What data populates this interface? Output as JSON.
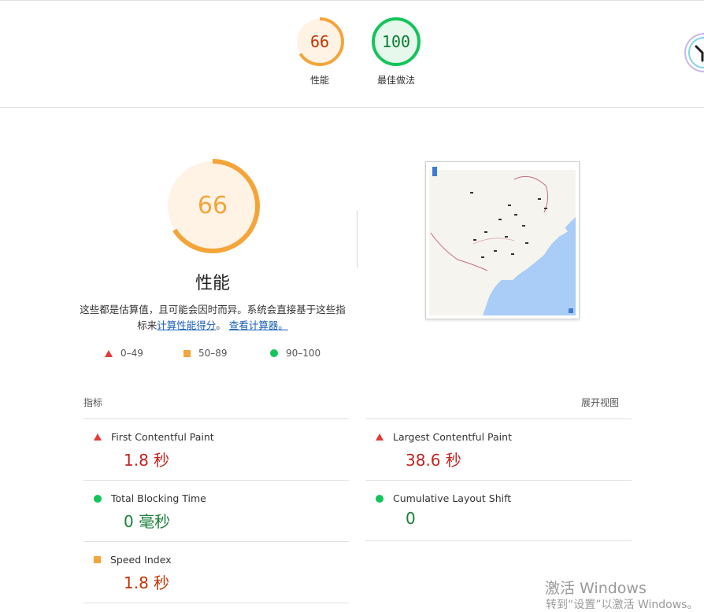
{
  "header": {
    "scores": [
      {
        "value": "66",
        "label": "性能",
        "fraction": 0.66,
        "color": "#f4a53a"
      },
      {
        "value": "100",
        "label": "最佳做法",
        "fraction": 1.0,
        "color": "#13c45a"
      }
    ]
  },
  "performance": {
    "score": "66",
    "fraction": 0.66,
    "title": "性能",
    "desc_text": "这些都是估算值，且可能会因时而异。系统会直接基于这些指标来",
    "desc_link1": "计算性能得分",
    "desc_sep": "。",
    "desc_link2": "查看计算器。",
    "legend": [
      "0–49",
      "50–89",
      "90–100"
    ]
  },
  "metrics": {
    "header_label": "指标",
    "expand_label": "展开视图",
    "items": [
      {
        "name": "First Contentful Paint",
        "value": "1.8 秒",
        "status": "fail"
      },
      {
        "name": "Largest Contentful Paint",
        "value": "38.6 秒",
        "status": "fail"
      },
      {
        "name": "Total Blocking Time",
        "value": "0 毫秒",
        "status": "pass"
      },
      {
        "name": "Cumulative Layout Shift",
        "value": "0",
        "status": "pass"
      },
      {
        "name": "Speed Index",
        "value": "1.8 秒",
        "status": "average"
      }
    ]
  },
  "watermark": {
    "line1": "激活 Windows",
    "line2": "转到“设置”以激活 Windows。"
  },
  "colors": {
    "fail": "#e53935",
    "average": "#f4a53a",
    "pass": "#13c45a",
    "link": "#1a5fb4"
  }
}
